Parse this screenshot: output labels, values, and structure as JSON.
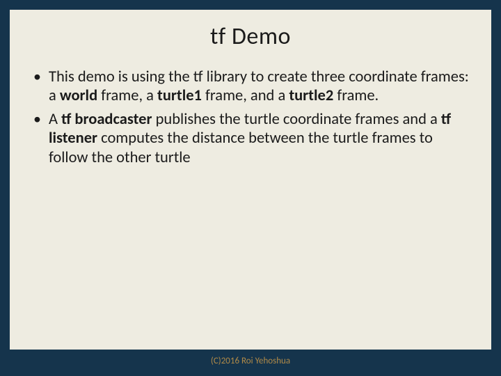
{
  "title": "tf Demo",
  "bullets": [
    {
      "pre": "This demo is using the tf library to create three coordinate frames: a ",
      "b1": "world",
      "mid1": " frame, a ",
      "b2": "turtle1",
      "mid2": " frame, and a ",
      "b3": "turtle2",
      "post": " frame."
    },
    {
      "pre": "A ",
      "b1": "tf broadcaster",
      "mid1": " publishes the turtle coordinate frames and a ",
      "b2": "tf listener",
      "mid2": " computes the distance between the turtle frames to follow the other turtle",
      "b3": "",
      "post": ""
    }
  ],
  "footer": "(C)2016 Roi Yehoshua"
}
